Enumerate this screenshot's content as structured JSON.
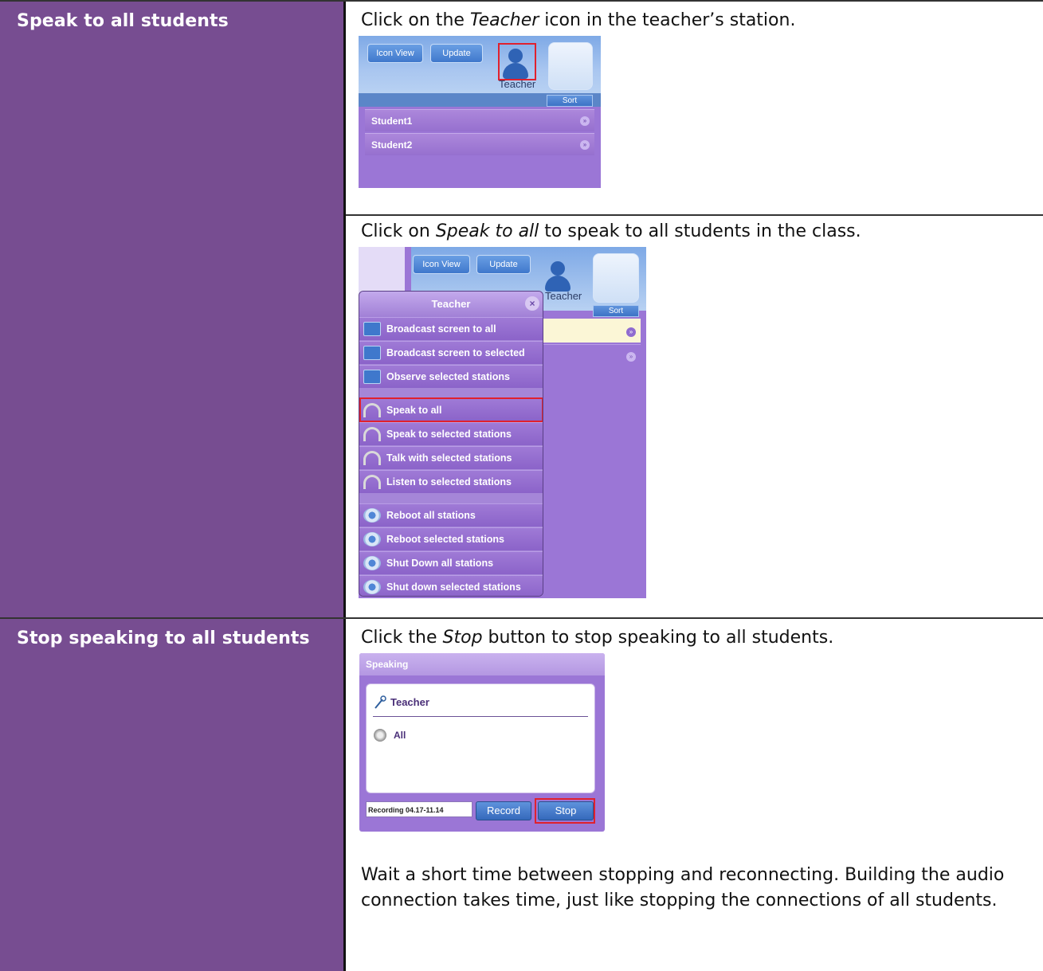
{
  "row1": {
    "heading": "Speak to all students",
    "instruction1": {
      "pre": "Click on the ",
      "em": "Teacher",
      "post": " icon in the teacher’s station."
    },
    "instruction2": {
      "pre": "Click on ",
      "em": "Speak to all",
      "post": " to speak to all students in the class."
    },
    "shot1": {
      "icon_view": "Icon View",
      "update": "Update",
      "teacher": "Teacher",
      "sort": "Sort",
      "students": [
        "Student1",
        "Student2"
      ],
      "more_glyph": "»"
    },
    "shot2": {
      "icon_view": "Icon View",
      "update": "Update",
      "teacher": "Teacher",
      "sort": "Sort",
      "menu_title": "Teacher",
      "close_glyph": "×",
      "more_glyph": "»",
      "items": [
        {
          "label": "Broadcast screen to all",
          "icon": "monitor-icon"
        },
        {
          "label": "Broadcast screen to selected",
          "icon": "monitor-icon"
        },
        {
          "label": "Observe selected stations",
          "icon": "monitor-icon"
        },
        {
          "label": "Speak to all",
          "icon": "headset-icon"
        },
        {
          "label": "Speak to selected stations",
          "icon": "headset-icon"
        },
        {
          "label": "Talk with selected stations",
          "icon": "headset-icon"
        },
        {
          "label": "Listen to selected stations",
          "icon": "headset-icon"
        },
        {
          "label": "Reboot all stations",
          "icon": "gear-icon"
        },
        {
          "label": "Reboot selected stations",
          "icon": "gear-icon"
        },
        {
          "label": "Shut Down all stations",
          "icon": "gear-icon"
        },
        {
          "label": "Shut down selected stations",
          "icon": "gear-icon"
        }
      ]
    }
  },
  "row2": {
    "heading": "Stop speaking to all students",
    "instruction": {
      "pre": "Click the ",
      "em": "Stop",
      "post": " button to stop speaking to all students."
    },
    "shot3": {
      "title": "Speaking",
      "speaker": "Teacher",
      "target": "All",
      "recording_name": "Recording 04.17-11.14",
      "record": "Record",
      "stop": "Stop"
    },
    "paragraph": "Wait a short time between stopping and reconnecting. Building the audio connection takes time, just like stopping the connections of all students."
  }
}
